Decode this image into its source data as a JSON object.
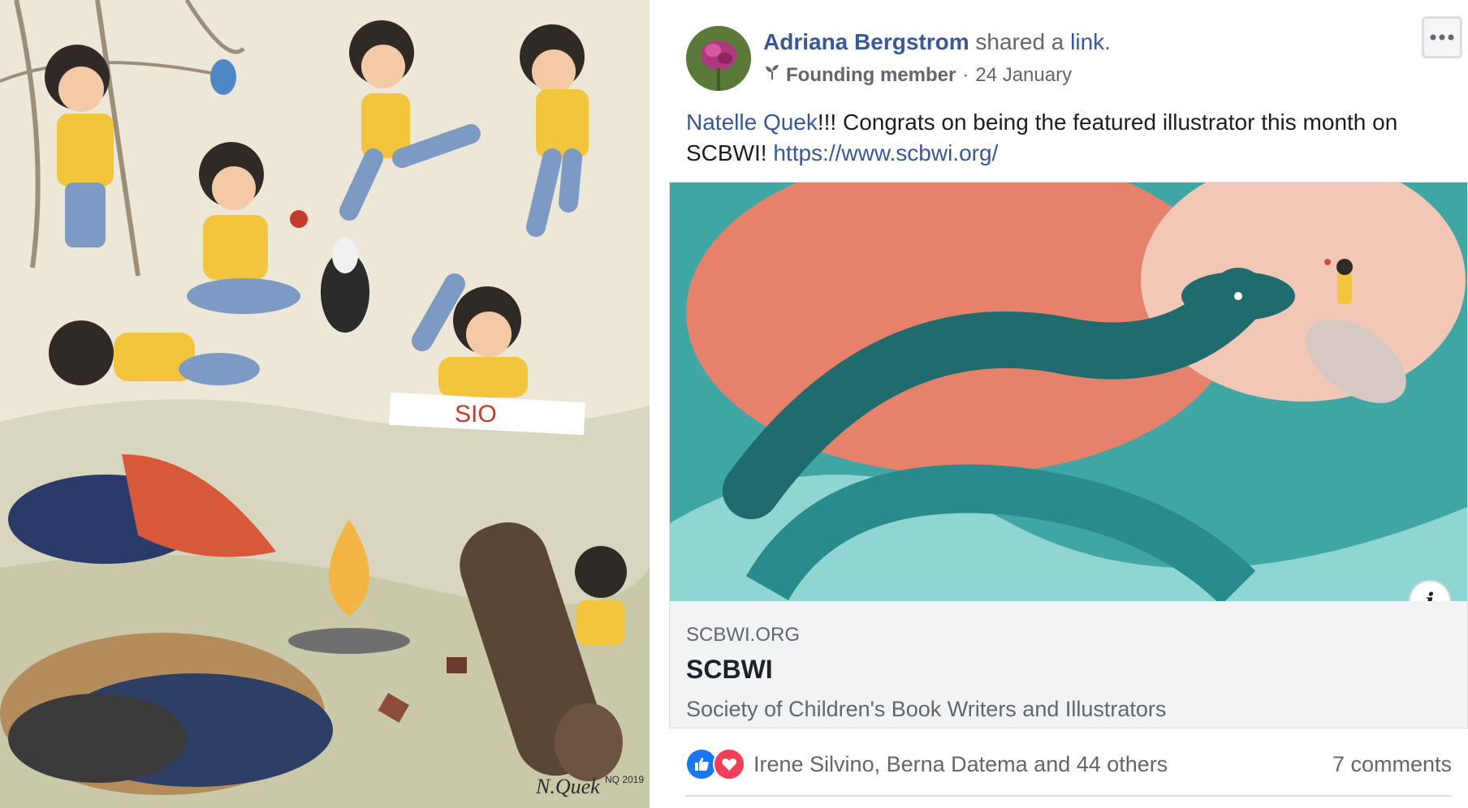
{
  "illustration": {
    "signature": "N.Quek",
    "signature_year": "NQ 2019",
    "drawing_word": "SIO"
  },
  "post": {
    "author": "Adriana Bergstrom",
    "shared_text": "shared a",
    "link_word": "link",
    "period": ".",
    "badge": "Founding member",
    "separator": "·",
    "date": "24 January",
    "mention": "Natelle Quek",
    "message": "!!! Congrats on being the featured illustrator this month on SCBWI! ",
    "url": "https://www.scbwi.org/",
    "more_icon": "ellipsis-icon",
    "link_card": {
      "domain": "SCBWI.ORG",
      "title": "SCBWI",
      "description": "Society of Children's Book Writers and Illustrators",
      "info_icon": "i"
    },
    "reactions": {
      "icons": [
        "like-icon",
        "love-icon"
      ],
      "names": "Irene Silvino, Berna Datema and 44 others",
      "comments": "7 comments"
    }
  },
  "colors": {
    "link_blue": "#385898",
    "text": "#1c1e21",
    "muted": "#606770",
    "like": "#1877f2",
    "love": "#f33e58",
    "card_bg": "#f2f3f5"
  }
}
